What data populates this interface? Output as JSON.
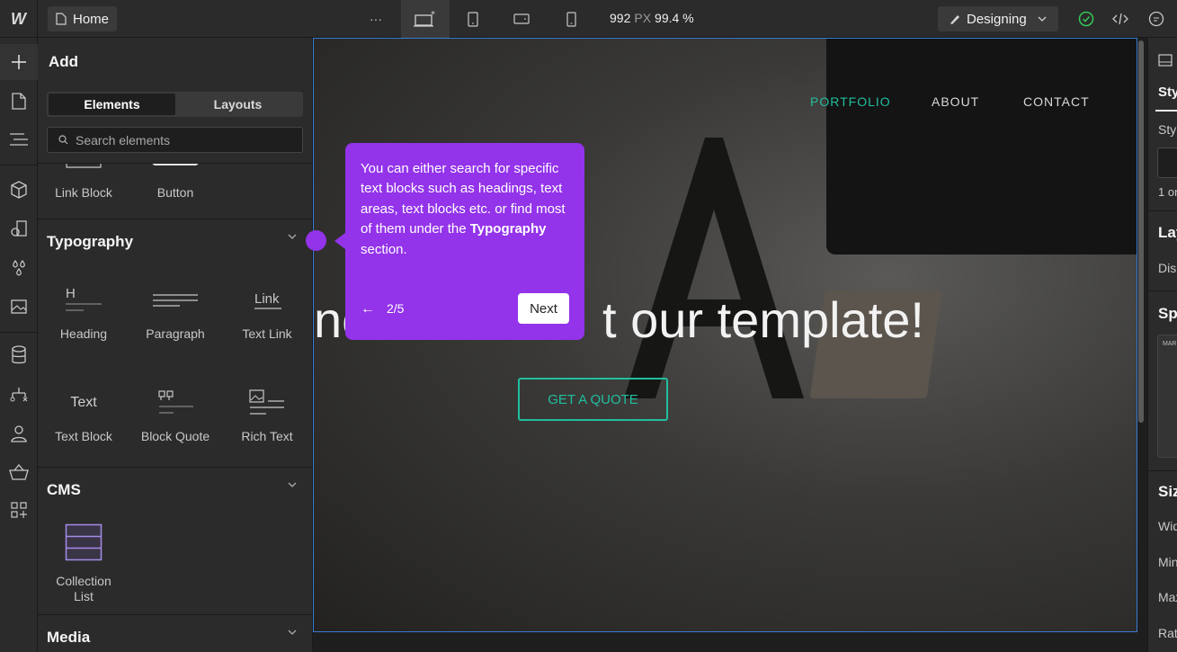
{
  "toolbar": {
    "logo": "W",
    "page_name": "Home",
    "more": "···",
    "width_px": "992",
    "width_unit": "PX",
    "zoom": "99.4 %",
    "mode": "Designing"
  },
  "add_panel": {
    "title": "Add",
    "tabs": [
      "Elements",
      "Layouts"
    ],
    "search_placeholder": "Search elements",
    "top_items": [
      "Link Block",
      "Button"
    ],
    "sections": {
      "typography": {
        "title": "Typography",
        "items": [
          "Heading",
          "Paragraph",
          "Text Link",
          "Text Block",
          "Block Quote",
          "Rich Text"
        ],
        "icon_text": {
          "heading": "H",
          "link": "Link",
          "text": "Text"
        }
      },
      "cms": {
        "title": "CMS",
        "items": [
          "Collection",
          "List"
        ]
      },
      "media": {
        "title": "Media"
      }
    }
  },
  "canvas": {
    "nav": [
      "PORTFOLIO",
      "ABOUT",
      "CONTACT"
    ],
    "hero_pre": "ne",
    "hero_post": "t our template!",
    "cta": "GET A QUOTE"
  },
  "tooltip": {
    "text_before": "You can either search for specific text blocks such as headings, text areas, text blocks etc. or find most of them under the",
    "bold": "Typography",
    "text_after": "section.",
    "back": "←",
    "step": "2/5",
    "next": "Next"
  },
  "right_panel": {
    "style_tab": "Sty",
    "style_label": "Sty",
    "selector_count": "1 or",
    "layout": "Lay",
    "display": "Disp",
    "spacing": "Spa",
    "margin": "MAR",
    "size": "Siz",
    "width": "Wid",
    "min": "Min",
    "max": "Max",
    "ratio": "Rat"
  },
  "colors": {
    "accent": "#9333ea",
    "teal": "#1fbf9f",
    "selection": "#3a7bd5"
  }
}
